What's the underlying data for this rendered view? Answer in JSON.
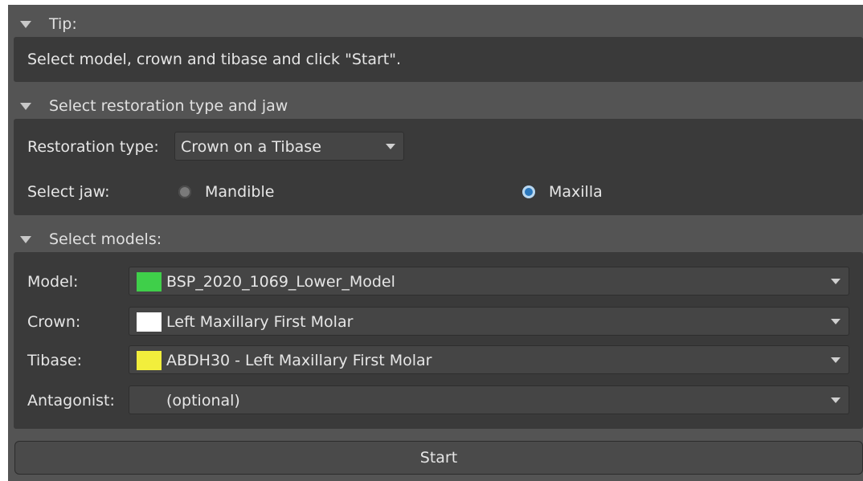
{
  "tip": {
    "header": "Tip:",
    "text": "Select model, crown and tibase and click \"Start\"."
  },
  "restoration": {
    "header": "Select restoration type and jaw",
    "type_label": "Restoration type:",
    "type_value": "Crown on a Tibase",
    "jaw_label": "Select jaw:",
    "jaw_options": [
      {
        "label": "Mandible",
        "checked": false
      },
      {
        "label": "Maxilla",
        "checked": true
      }
    ]
  },
  "models": {
    "header": "Select models:",
    "rows": [
      {
        "label": "Model:",
        "value": "BSP_2020_1069_Lower_Model",
        "color": "#3fcf4a"
      },
      {
        "label": "Crown:",
        "value": "Left Maxillary First Molar",
        "color": "#ffffff"
      },
      {
        "label": "Tibase:",
        "value": "ABDH30 - Left Maxillary First Molar",
        "color": "#f2ee3c"
      },
      {
        "label": "Antagonist:",
        "value": "(optional)",
        "color": null
      }
    ]
  },
  "start_label": "Start"
}
